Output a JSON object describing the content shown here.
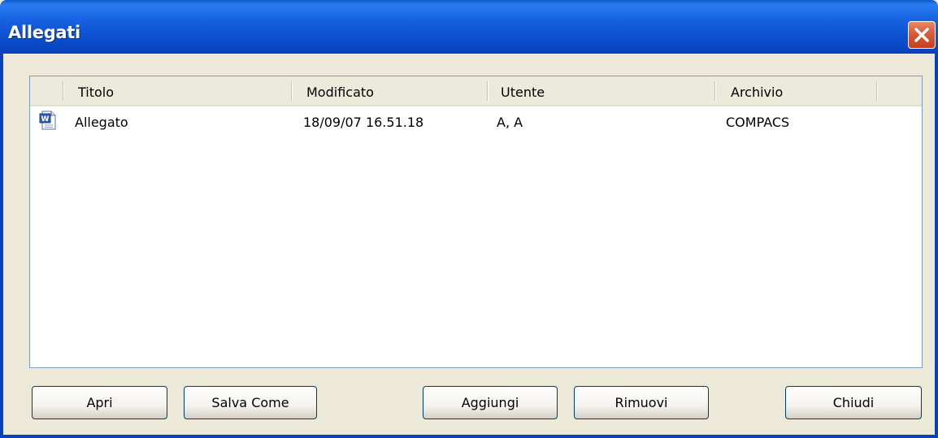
{
  "window": {
    "title": "Allegati"
  },
  "list": {
    "columns": [
      "Titolo",
      "Modificato",
      "Utente",
      "Archivio"
    ],
    "rows": [
      {
        "icon": "word-document-icon",
        "titolo": "Allegato",
        "modificato": "18/09/07 16.51.18",
        "utente": "A, A",
        "archivio": "COMPACS"
      }
    ]
  },
  "buttons": {
    "apri": "Apri",
    "salva_come": "Salva Come",
    "aggiungi": "Aggiungi",
    "rimuovi": "Rimuovi",
    "chiudi": "Chiudi"
  },
  "colors": {
    "titlebar": "#0b4ccc",
    "dialog_bg": "#ece9d8",
    "close_button": "#d95a3a",
    "list_border": "#7f9db9"
  }
}
